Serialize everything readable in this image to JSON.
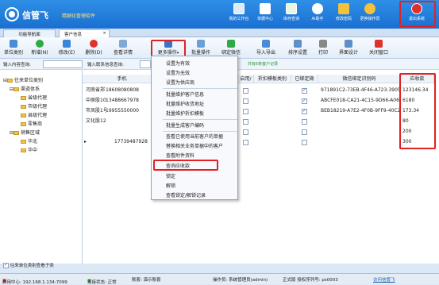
{
  "header": {
    "brand": "信管飞",
    "tagline": "精细化管理软件",
    "buttons": [
      {
        "label": "我的工作台",
        "icon": "monitor-icon",
        "color": "#3a7bd5"
      },
      {
        "label": "单据中心",
        "icon": "document-icon",
        "color": "#ffffff"
      },
      {
        "label": "库存查询",
        "icon": "grid-icon",
        "color": "#ffffff"
      },
      {
        "label": "AI助手",
        "icon": "robot-icon",
        "color": "#ffffff"
      },
      {
        "label": "修改密码",
        "icon": "lock-icon",
        "color": "#f3c13a"
      },
      {
        "label": "更换操作员",
        "icon": "user-icon",
        "color": "#f3c13a"
      },
      {
        "label": "退出系统",
        "icon": "power-icon",
        "color": "#e0302b"
      }
    ]
  },
  "tabs": [
    {
      "label": "功能导航面"
    },
    {
      "label": "客户信息"
    }
  ],
  "toolbar": {
    "buttons": [
      {
        "label": "单位类别",
        "icon": "category-icon"
      },
      {
        "label": "新增(N)",
        "icon": "add-icon"
      },
      {
        "label": "修改(E)",
        "icon": "edit-icon"
      },
      {
        "label": "删除(D)",
        "icon": "delete-icon"
      },
      {
        "label": "查看详情",
        "icon": "detail-icon"
      },
      {
        "label": "更多操作",
        "icon": "more-icon"
      },
      {
        "label": "批量操作",
        "icon": "batch-icon"
      },
      {
        "label": "绑定微信",
        "icon": "wechat-icon"
      },
      {
        "label": "导入导出",
        "icon": "import-export-icon"
      },
      {
        "label": "排序设置",
        "icon": "sort-icon"
      },
      {
        "label": "打印",
        "icon": "print-icon"
      },
      {
        "label": "界面设计",
        "icon": "design-icon"
      },
      {
        "label": "关闭窗口",
        "icon": "close-window-icon"
      }
    ]
  },
  "filter": {
    "input_label": "输入内容查询:",
    "contact_label": "输入联系信息查询:",
    "customer_count": "共有6条客户记录"
  },
  "tree": {
    "items": [
      {
        "label": "往来单位类别",
        "level": 0
      },
      {
        "label": "渠道体系",
        "level": 1
      },
      {
        "label": "省级代理",
        "level": 2
      },
      {
        "label": "市级代理",
        "level": 2
      },
      {
        "label": "县级代理",
        "level": 2
      },
      {
        "label": "零售商",
        "level": 2
      },
      {
        "label": "销售区域",
        "level": 1
      },
      {
        "label": "华北",
        "level": 2
      },
      {
        "label": "华中",
        "level": 2
      }
    ],
    "checkbox_label": "往来单位类别查看子类"
  },
  "grid": {
    "headers": [
      "手机",
      "启用/",
      "折扣模板类别",
      "已绑定微",
      "微信绑定识别码",
      "应收款"
    ],
    "rows": [
      {
        "name": "河南省郑",
        "phone": "18608080808",
        "bound": true,
        "code": "971891C2-73EB-4F46-A723-3905",
        "amount": "123146.34"
      },
      {
        "name": "中原股100",
        "phone": "13488667978",
        "bound": true,
        "code": "ABCFE018-CA21-4C15-9D66-A06A",
        "amount": "6180"
      },
      {
        "name": "市凤股1号",
        "phone": "19955550000",
        "bound": true,
        "code": "BEB18219-A7E2-4F0B-9FF9-40C2",
        "amount": "173.34"
      },
      {
        "name": "文化股126",
        "phone": "",
        "bound": false,
        "code": "",
        "amount": "80"
      },
      {
        "name": "",
        "phone": "",
        "bound": false,
        "code": "",
        "amount": "200"
      },
      {
        "name": "",
        "phone": "17739487928",
        "bound": false,
        "code": "",
        "amount": "300"
      }
    ]
  },
  "menu": {
    "items": [
      "设置为有效",
      "设置为无效",
      "设置为供应商",
      "批量维护客户信息",
      "批量维护收货地址",
      "批量维护折扣模板",
      "批量生成客户编码",
      "查看已使用当前客户的单据",
      "替换相关业务单据中的客户",
      "查看附件资料",
      "查询应收款",
      "锁定",
      "解锁",
      "查看锁定/解锁记录"
    ]
  },
  "status": {
    "server": "启用中心: 192.168.1.134:7099",
    "connection": "连接状态: 正常",
    "account": "账套: 演示账套",
    "operator": "操作员: 系统管理员(admin)",
    "version": "正式版 授权序列号: ps0003",
    "support": "访问信管飞"
  }
}
